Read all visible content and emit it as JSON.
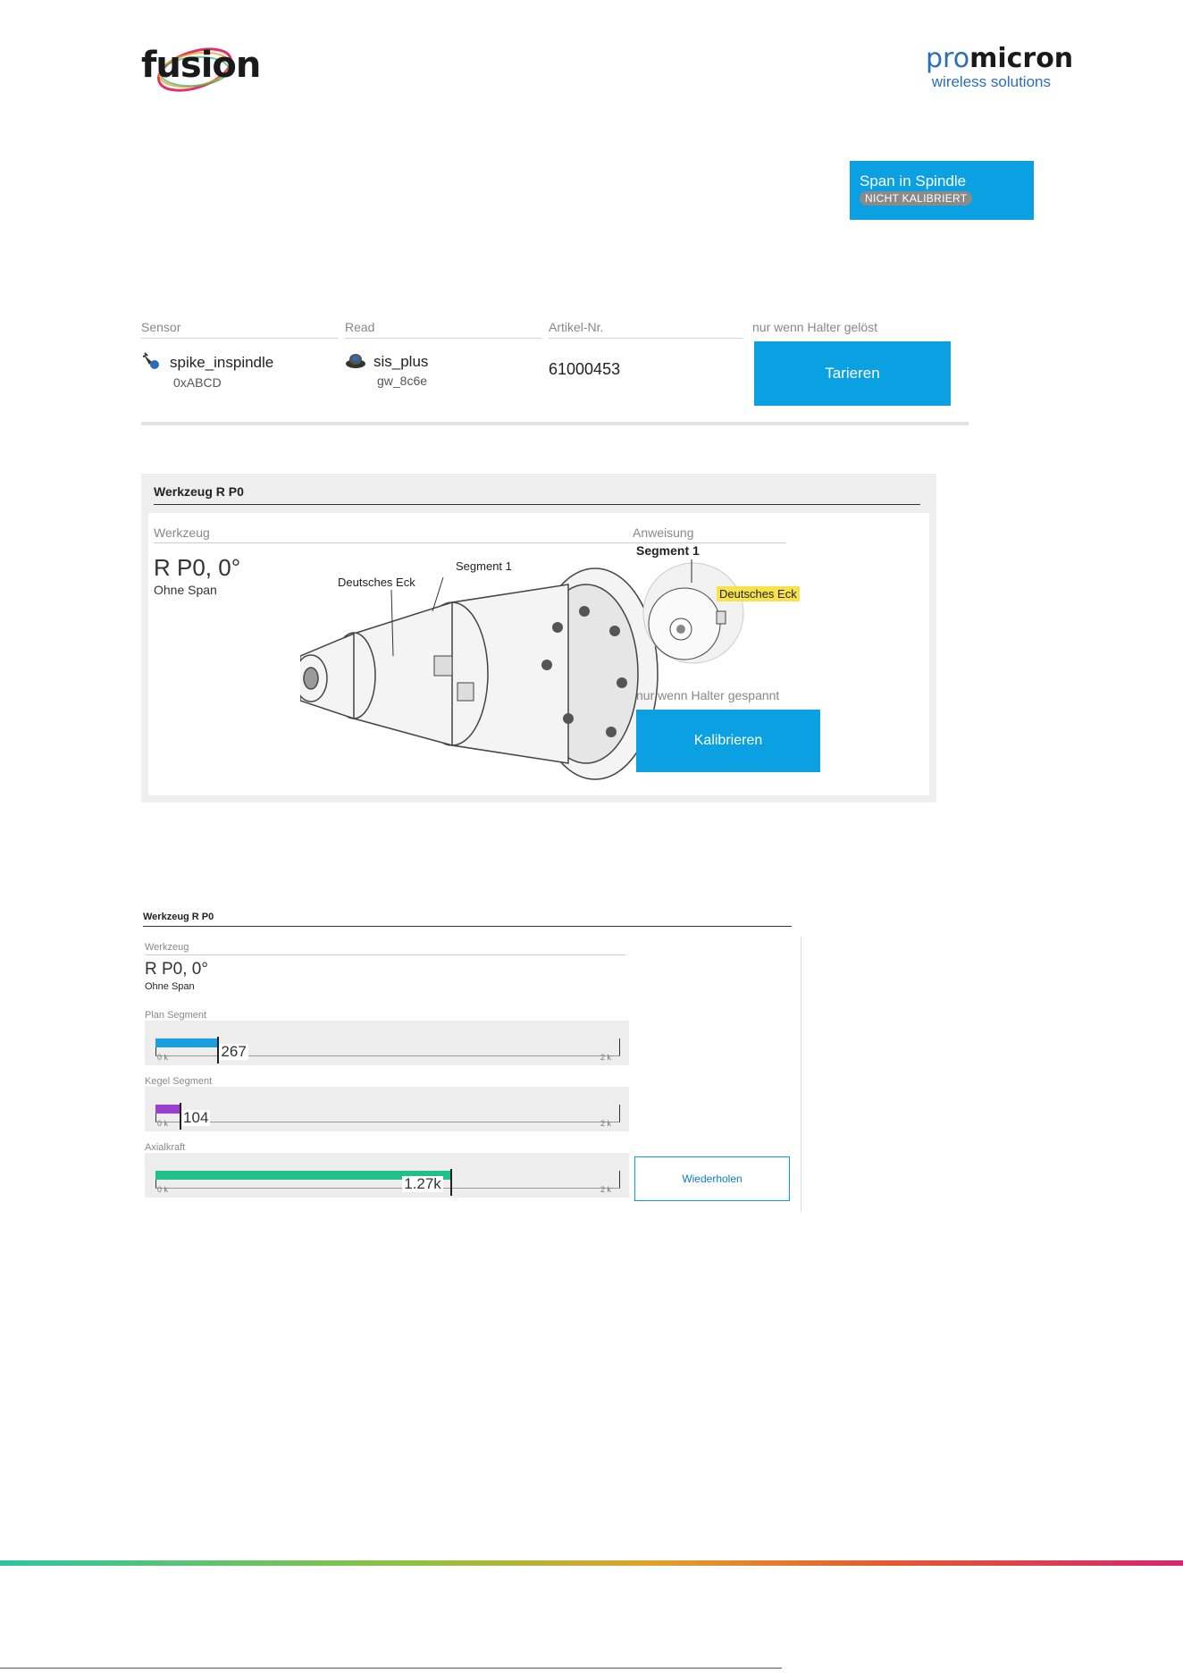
{
  "logos": {
    "left": "fusion",
    "right_brand_a": "pro",
    "right_brand_b": "micron",
    "right_tagline": "wireless solutions"
  },
  "status": {
    "title": "Span in Spindle",
    "badge": "NICHT KALIBRIERT"
  },
  "sensor_panel": {
    "sensor": {
      "header": "Sensor",
      "name": "spike_inspindle",
      "id": "0xABCD"
    },
    "read": {
      "header": "Read",
      "name": "sis_plus",
      "id": "gw_8c6e"
    },
    "article": {
      "header": "Artikel-Nr.",
      "value": "61000453"
    },
    "tare": {
      "header": "nur wenn Halter gelöst",
      "label": "Tarieren"
    }
  },
  "tool_panel": {
    "title": "Werkzeug R P0",
    "tool_header": "Werkzeug",
    "tool_name": "R P0, 0°",
    "tool_sub": "Ohne Span",
    "callout_1": "Deutsches Eck",
    "callout_2": "Segment 1",
    "instruction_header": "Anweisung",
    "instruction_segment": "Segment 1",
    "instruction_corner": "Deutsches Eck",
    "calibrate_header": "nur wenn Halter gespannt",
    "calibrate_label": "Kalibrieren"
  },
  "tool_panel_2": {
    "title": "Werkzeug R P0",
    "tool_header": "Werkzeug",
    "tool_name": "R P0, 0°",
    "tool_sub": "Ohne Span",
    "bars": [
      {
        "label": "Plan Segment",
        "value_text": "267",
        "value": 267,
        "max": 2000,
        "lo": "0 k",
        "hi": "2 k",
        "color": "#1a9ee0"
      },
      {
        "label": "Kegel Segment",
        "value_text": "104",
        "value": 104,
        "max": 2000,
        "lo": "0 k",
        "hi": "2 k",
        "color": "#9b3fd1"
      },
      {
        "label": "Axialkraft",
        "value_text": "1.27k",
        "value": 1270,
        "max": 2000,
        "lo": "0 k",
        "hi": "2 k",
        "color": "#21c08a"
      }
    ],
    "repeat_label": "Wiederholen"
  },
  "colors": {
    "accent": "#0aa0e2",
    "badge": "#8a8a8a"
  }
}
